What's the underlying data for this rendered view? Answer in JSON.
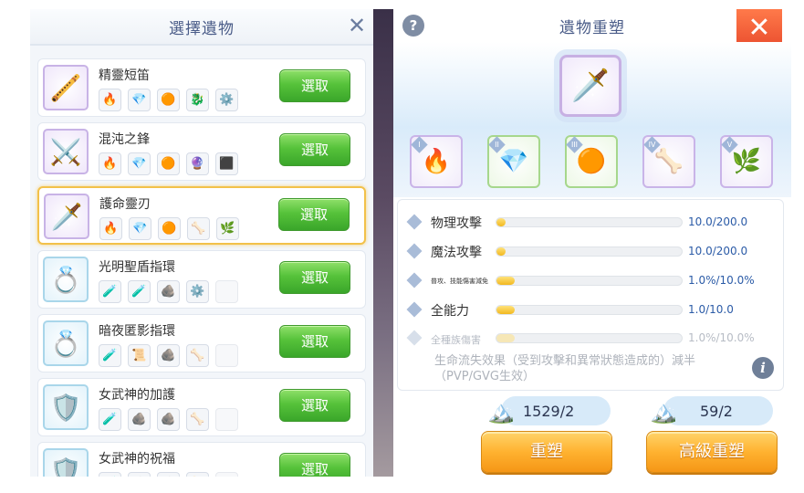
{
  "picker": {
    "title": "選擇遺物",
    "close_icon": "close-icon",
    "select_label": "選取",
    "items": [
      {
        "name": "精靈短笛",
        "icon": "🪈",
        "thumb_color": "purple",
        "selected": false,
        "materials": [
          "🔥",
          "💎",
          "🟠",
          "🐉",
          "⚙️"
        ]
      },
      {
        "name": "混沌之鋒",
        "icon": "⚔️",
        "thumb_color": "purple",
        "selected": false,
        "materials": [
          "🔥",
          "💎",
          "🟠",
          "🔮",
          "⬛"
        ]
      },
      {
        "name": "護命靈刃",
        "icon": "🗡️",
        "thumb_color": "purple",
        "selected": true,
        "materials": [
          "🔥",
          "💎",
          "🟠",
          "🦴",
          "🌿"
        ]
      },
      {
        "name": "光明聖盾指環",
        "icon": "💍",
        "thumb_color": "blue",
        "selected": false,
        "materials": [
          "🧪",
          "🧪",
          "🪨",
          "⚙️",
          ""
        ]
      },
      {
        "name": "暗夜匿影指環",
        "icon": "💍",
        "thumb_color": "blue",
        "selected": false,
        "materials": [
          "🧪",
          "📜",
          "🪨",
          "🦴",
          ""
        ]
      },
      {
        "name": "女武神的加護",
        "icon": "🛡️",
        "thumb_color": "blue",
        "selected": false,
        "materials": [
          "🧪",
          "🪨",
          "🪨",
          "🦴",
          ""
        ]
      },
      {
        "name": "女武神的祝福",
        "icon": "🛡️",
        "thumb_color": "blue",
        "selected": false,
        "materials": [
          "🧪",
          "🪨",
          "🪨",
          "🦴",
          ""
        ]
      }
    ]
  },
  "reforge": {
    "title": "遺物重塑",
    "help_icon": "question-icon",
    "close_icon": "close-icon",
    "current_item_icon": "🗡️",
    "slots": [
      {
        "num": "I",
        "icon": "🔥",
        "color": "purple"
      },
      {
        "num": "II",
        "icon": "💎",
        "color": "green"
      },
      {
        "num": "III",
        "icon": "🟠",
        "color": "green"
      },
      {
        "num": "IV",
        "icon": "🦴",
        "color": "purple"
      },
      {
        "num": "V",
        "icon": "🌿",
        "color": "purple"
      }
    ],
    "stats": [
      {
        "name": "物理攻擊",
        "value": "10.0/200.0",
        "fill": 0.05,
        "style": "normal"
      },
      {
        "name": "魔法攻擊",
        "value": "10.0/200.0",
        "fill": 0.05,
        "style": "normal"
      },
      {
        "name": "普攻、技能傷害減免",
        "value": "1.0%/10.0%",
        "fill": 0.1,
        "style": "small"
      },
      {
        "name": "全能力",
        "value": "1.0/10.0",
        "fill": 0.1,
        "style": "normal"
      },
      {
        "name": "全種族傷害",
        "value": "1.0%/10.0%",
        "fill": 0.1,
        "style": "faded"
      }
    ],
    "note": "生命流失效果（受到攻擊和異常狀態造成的）減半（PVP/GVG生效）",
    "info_icon": "info-icon",
    "currencies": [
      {
        "icon": "🏔️",
        "value": "1529/2"
      },
      {
        "icon": "🏔️",
        "value": "59/2"
      }
    ],
    "reforge_label": "重塑",
    "advanced_reforge_label": "高級重塑"
  }
}
